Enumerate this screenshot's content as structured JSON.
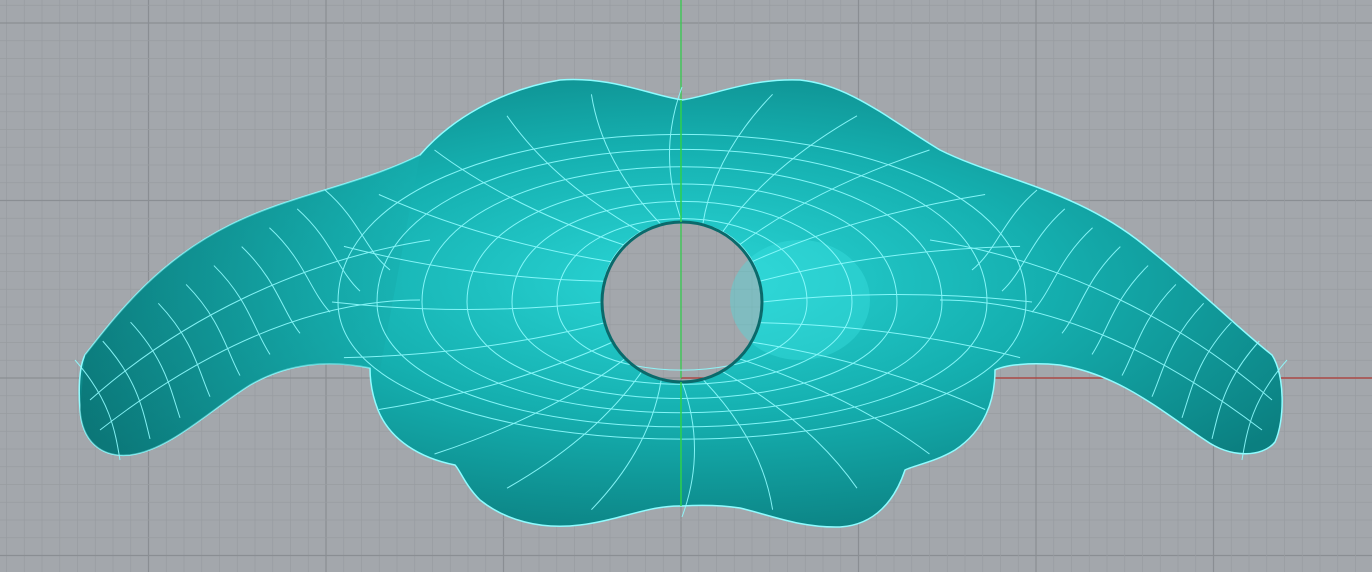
{
  "viewport": {
    "view": "perspective",
    "background_color": "#a3a7ac",
    "minor_grid_color": "#989ca1",
    "major_grid_color": "#8a8e93",
    "x_axis_color": "#b03a35",
    "y_axis_color": "#2fd14a",
    "object_color": "#17b3b3",
    "isocurve_color": "#8ffcff"
  }
}
